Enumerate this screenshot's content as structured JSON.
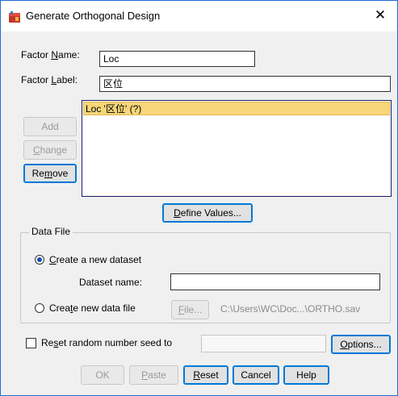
{
  "window": {
    "title": "Generate Orthogonal Design",
    "close_glyph": "✕"
  },
  "factor": {
    "name_label_pre": "Factor ",
    "name_label_u": "N",
    "name_label_post": "ame:",
    "name_value": "Loc",
    "label_label_pre": "Factor ",
    "label_label_u": "L",
    "label_label_post": "abel:",
    "label_value": "区位"
  },
  "list": {
    "items": [
      "Loc '区位' (?)"
    ]
  },
  "side_buttons": {
    "add": "Add",
    "change_u": "C",
    "change_rest": "hange",
    "remove_pre": "Re",
    "remove_u": "m",
    "remove_post": "ove"
  },
  "define_values": {
    "u": "D",
    "rest": "efine Values..."
  },
  "data_file": {
    "group_title": "Data File",
    "option1_u": "C",
    "option1_rest": "reate a new dataset",
    "dataset_name_label": "Dataset name:",
    "dataset_name_value": "",
    "option2_pre": "Crea",
    "option2_u": "t",
    "option2_post": "e new data file",
    "file_button_u": "F",
    "file_button_rest": "ile...",
    "file_path": "C:\\Users\\WC\\Doc...\\ORTHO.sav"
  },
  "seed": {
    "label_pre": "Re",
    "label_u": "s",
    "label_post": "et random number seed to",
    "value": ""
  },
  "options_button": {
    "u": "O",
    "rest": "ptions..."
  },
  "bottom_buttons": {
    "ok": "OK",
    "paste_u": "P",
    "paste_rest": "aste",
    "reset_u": "R",
    "reset_rest": "eset",
    "cancel": "Cancel",
    "help": "Help"
  },
  "colors": {
    "accent": "#0078d7",
    "selection": "#f7d67a",
    "border": "#1f6fd1"
  }
}
